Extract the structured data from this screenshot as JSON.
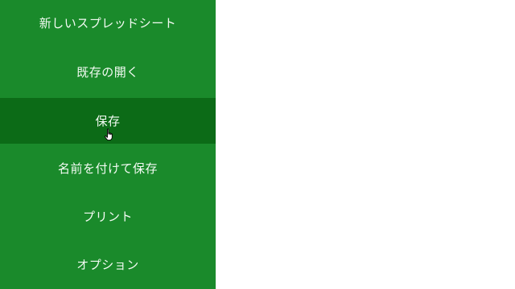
{
  "file_menu": {
    "items": [
      {
        "label": "新しいスプレッドシート",
        "selected": false
      },
      {
        "label": "既存の開く",
        "selected": false
      },
      {
        "label": "保存",
        "selected": true
      },
      {
        "label": "名前を付けて保存",
        "selected": false
      },
      {
        "label": "プリント",
        "selected": false
      },
      {
        "label": "オプション",
        "selected": false
      }
    ]
  },
  "colors": {
    "menu_background": "#1a8a2b",
    "selected_item_background": "#0c6b17",
    "menu_text": "#f4fbf4",
    "content_background": "#ffffff"
  },
  "cursor": {
    "icon": "hand-pointer-icon"
  }
}
